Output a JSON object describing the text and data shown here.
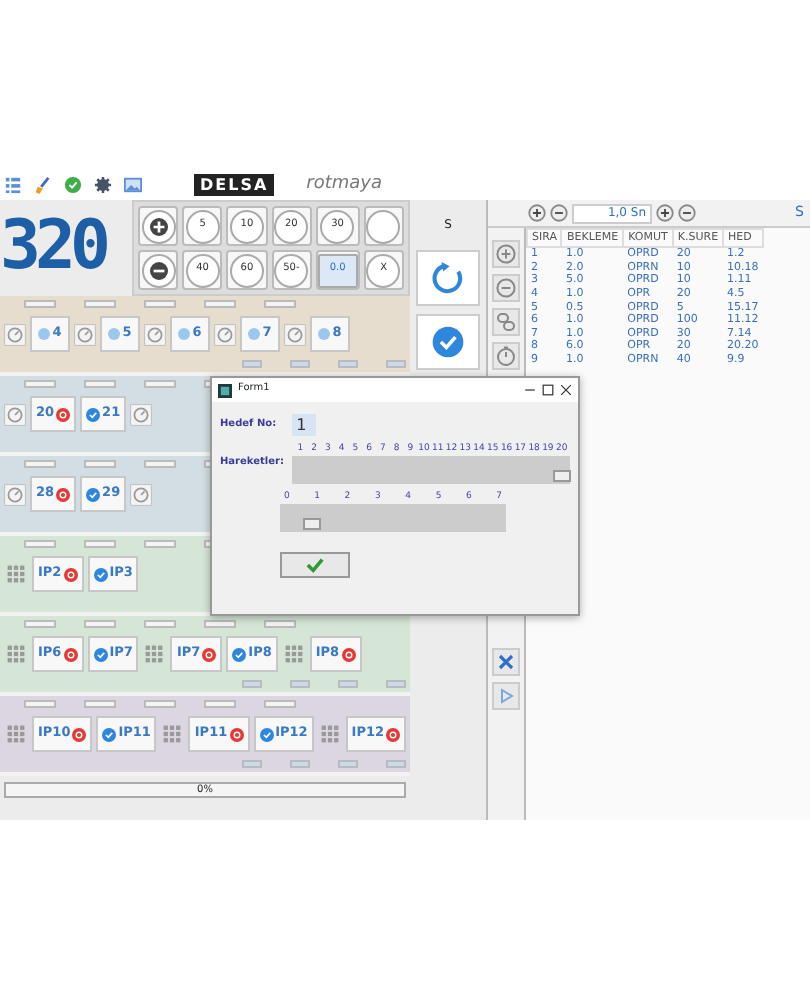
{
  "toolbar": {
    "logo": "DELSA",
    "brand": "rotmaya"
  },
  "display": "320",
  "step_buttons": [
    {
      "kind": "plus"
    },
    {
      "kind": "text",
      "label": "5"
    },
    {
      "kind": "text",
      "label": "10"
    },
    {
      "kind": "text",
      "label": "20"
    },
    {
      "kind": "text",
      "label": "30"
    },
    {
      "kind": "blank"
    },
    {
      "kind": "minus"
    },
    {
      "kind": "text",
      "label": "40"
    },
    {
      "kind": "text",
      "label": "60"
    },
    {
      "kind": "text",
      "label": "50-"
    },
    {
      "kind": "spin",
      "label": "0.0"
    },
    {
      "kind": "text",
      "label": "X"
    }
  ],
  "side": {
    "label": "S"
  },
  "program": {
    "step": "1,0 Sn",
    "corner": "S",
    "columns": [
      "SIRA",
      "BEKLEME",
      "KOMUT",
      "K.SURE",
      "HED"
    ],
    "rows": [
      [
        "1",
        "1.0",
        "OPRD",
        "20",
        "1.2"
      ],
      [
        "2",
        "2.0",
        "OPRN",
        "10",
        "10.18"
      ],
      [
        "3",
        "5.0",
        "OPRD",
        "10",
        "1.11"
      ],
      [
        "4",
        "1.0",
        "OPR",
        "20",
        "4.5"
      ],
      [
        "5",
        "0.5",
        "OPRD",
        "5",
        "15.17"
      ],
      [
        "6",
        "1.0",
        "OPRD",
        "100",
        "11.12"
      ],
      [
        "7",
        "1.0",
        "OPRD",
        "30",
        "7.14"
      ],
      [
        "8",
        "6.0",
        "OPR",
        "20",
        "20.20"
      ],
      [
        "9",
        "1.0",
        "OPRN",
        "40",
        "9.9"
      ]
    ]
  },
  "device_rows": [
    {
      "color": "#e6ddcf",
      "cells": [
        {
          "kind": "gauge"
        },
        {
          "kind": "dot",
          "label": "4"
        },
        {
          "kind": "gauge"
        },
        {
          "kind": "dot",
          "label": "5"
        },
        {
          "kind": "gauge"
        },
        {
          "kind": "dot",
          "label": "6"
        },
        {
          "kind": "gauge"
        },
        {
          "kind": "dot",
          "label": "7"
        },
        {
          "kind": "gauge"
        },
        {
          "kind": "dot",
          "label": "8"
        }
      ]
    },
    {
      "color": "#d2dee3",
      "cells": [
        {
          "kind": "gauge"
        },
        {
          "kind": "error",
          "label": "20"
        },
        {
          "kind": "ok",
          "label": "21"
        },
        {
          "kind": "gauge"
        }
      ]
    },
    {
      "color": "#d2dee3",
      "cells": [
        {
          "kind": "gauge"
        },
        {
          "kind": "error",
          "label": "28"
        },
        {
          "kind": "ok",
          "label": "29"
        },
        {
          "kind": "gauge"
        }
      ]
    },
    {
      "color": "#d6e6d6",
      "cells": [
        {
          "kind": "keypad"
        },
        {
          "kind": "error",
          "label": "IP2"
        },
        {
          "kind": "ok",
          "label": "IP3"
        }
      ]
    },
    {
      "color": "#d6e6d6",
      "cells": [
        {
          "kind": "keypad"
        },
        {
          "kind": "error",
          "label": "IP6"
        },
        {
          "kind": "ok",
          "label": "IP7"
        },
        {
          "kind": "keypad"
        },
        {
          "kind": "error",
          "label": "IP7"
        },
        {
          "kind": "ok",
          "label": "IP8"
        },
        {
          "kind": "keypad"
        },
        {
          "kind": "error",
          "label": "IP8"
        }
      ]
    },
    {
      "color": "#dcd6e3",
      "cells": [
        {
          "kind": "keypad"
        },
        {
          "kind": "error",
          "label": "IP10"
        },
        {
          "kind": "ok",
          "label": "IP11"
        },
        {
          "kind": "keypad"
        },
        {
          "kind": "error",
          "label": "IP11"
        },
        {
          "kind": "ok",
          "label": "IP12"
        },
        {
          "kind": "keypad"
        },
        {
          "kind": "error",
          "label": "IP12"
        }
      ]
    }
  ],
  "progress": {
    "label": "0%",
    "level": 0
  },
  "dialog": {
    "title": "Form1",
    "target_label": "Hedef No:",
    "target_value": "1",
    "moves_label": "Hareketler:",
    "scale_1": {
      "ticks": [
        "1",
        "2",
        "3",
        "4",
        "5",
        "6",
        "7",
        "8",
        "9",
        "10",
        "11",
        "12",
        "13",
        "14",
        "15",
        "16",
        "17",
        "18",
        "19",
        "20"
      ],
      "level": 0.97
    },
    "scale_2": {
      "ticks": [
        "0",
        "1",
        "2",
        "3",
        "4",
        "5",
        "6",
        "7"
      ],
      "level": 0.14
    }
  }
}
